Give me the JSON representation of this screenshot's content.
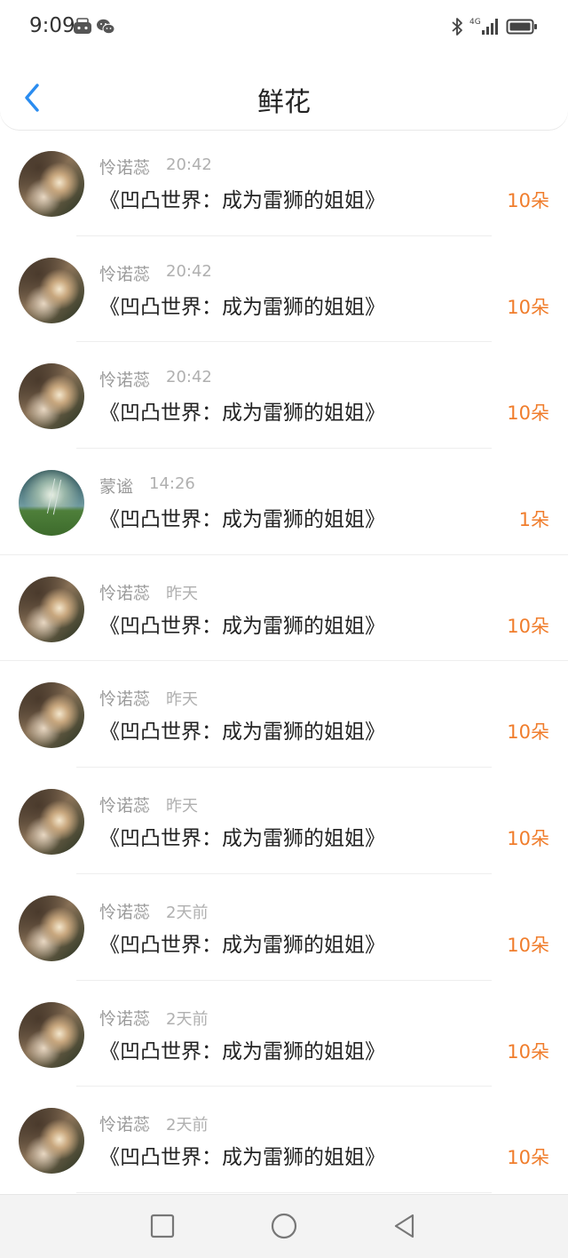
{
  "status_bar": {
    "time": "9:09",
    "icons": [
      "game-controller-icon",
      "wechat-icon",
      "bluetooth-icon",
      "4g-icon",
      "signal-icon",
      "battery-icon"
    ],
    "network": "4G"
  },
  "header": {
    "title": "鲜花",
    "back_icon": "chevron-left-icon",
    "accent_color": "#2a8cf0"
  },
  "items": [
    {
      "username": "怜诺蕊",
      "time": "20:42",
      "title": "《凹凸世界：成为雷狮的姐姐》",
      "count": "10朵",
      "avatar": "a"
    },
    {
      "username": "怜诺蕊",
      "time": "20:42",
      "title": "《凹凸世界：成为雷狮的姐姐》",
      "count": "10朵",
      "avatar": "a"
    },
    {
      "username": "怜诺蕊",
      "time": "20:42",
      "title": "《凹凸世界：成为雷狮的姐姐》",
      "count": "10朵",
      "avatar": "a"
    },
    {
      "username": "蒙谧",
      "time": "14:26",
      "title": "《凹凸世界：成为雷狮的姐姐》",
      "count": "1朵",
      "avatar": "b"
    },
    {
      "username": "怜诺蕊",
      "time": "昨天",
      "title": "《凹凸世界：成为雷狮的姐姐》",
      "count": "10朵",
      "avatar": "a"
    },
    {
      "username": "怜诺蕊",
      "time": "昨天",
      "title": "《凹凸世界：成为雷狮的姐姐》",
      "count": "10朵",
      "avatar": "a"
    },
    {
      "username": "怜诺蕊",
      "time": "昨天",
      "title": "《凹凸世界：成为雷狮的姐姐》",
      "count": "10朵",
      "avatar": "a"
    },
    {
      "username": "怜诺蕊",
      "time": "2天前",
      "title": "《凹凸世界：成为雷狮的姐姐》",
      "count": "10朵",
      "avatar": "a"
    },
    {
      "username": "怜诺蕊",
      "time": "2天前",
      "title": "《凹凸世界：成为雷狮的姐姐》",
      "count": "10朵",
      "avatar": "a"
    },
    {
      "username": "怜诺蕊",
      "time": "2天前",
      "title": "《凹凸世界：成为雷狮的姐姐》",
      "count": "10朵",
      "avatar": "a"
    }
  ],
  "system_nav": {
    "icons": [
      "recent-apps-icon",
      "home-icon",
      "back-triangle-icon"
    ]
  },
  "colors": {
    "count": "#f07d2c",
    "username": "#9a9a9a",
    "time": "#b0b0b0",
    "title": "#222222"
  }
}
